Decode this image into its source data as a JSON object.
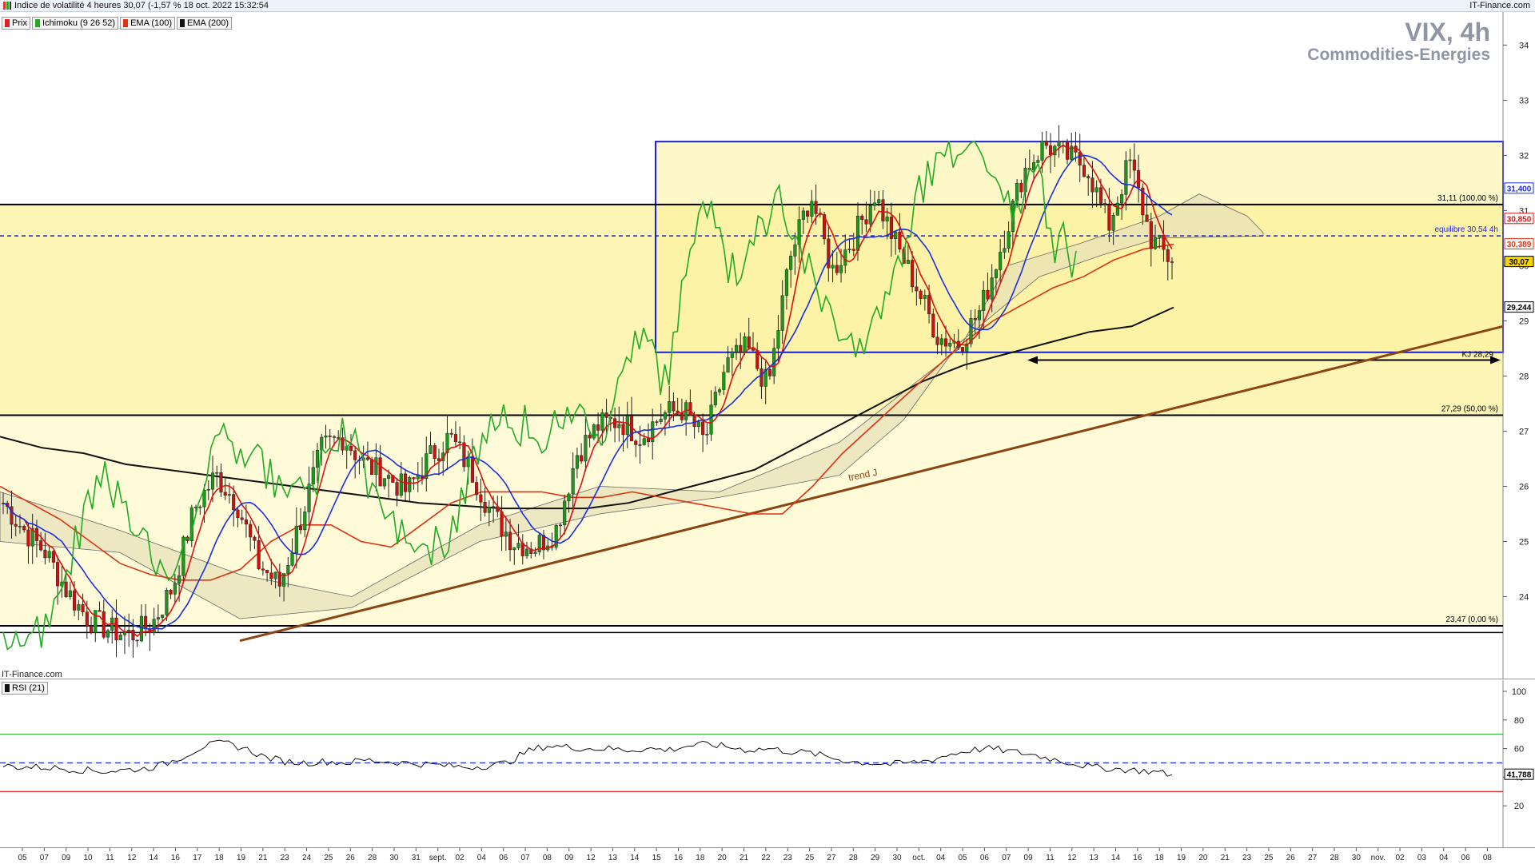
{
  "header": {
    "title": "Indice de volatilité 4 heures 30,07 (-1,57 % 18 oct. 2022 15:32:54",
    "source": "IT-Finance.com"
  },
  "legend": [
    {
      "label": "Prix",
      "color": "#dd2222"
    },
    {
      "label": "Ichimoku (9 26 52)",
      "color": "#22aa22"
    },
    {
      "label": "EMA (100)",
      "color": "#dd3311"
    },
    {
      "label": "EMA (200)",
      "color": "#111111"
    }
  ],
  "symbol": {
    "name": "VIX, 4h",
    "sector": "Commodities-Energies"
  },
  "watermark": "IT-Finance.com",
  "rsi_label": "RSI (21)",
  "colors": {
    "zone_fill": "#fdf5b5",
    "zone_light": "#fffbd9",
    "rect_stroke": "#1a1fd8",
    "trend": "#8b4513",
    "ema100": "#dd3311",
    "ema200": "#111111",
    "tenkan": "#dd1111",
    "kijun": "#1a2fdc",
    "chikou": "#22aa22",
    "cloud": "#e6dfb8",
    "rsi_line": "#111111"
  },
  "chart_data": {
    "type": "line",
    "title": "VIX, 4h",
    "subtitle": "Commodities-Energies",
    "ylim": [
      22.5,
      34.6
    ],
    "y_ticks": [
      24,
      25,
      26,
      27,
      28,
      29,
      30,
      31,
      32,
      33,
      34
    ],
    "y_tick_labels": [
      "24",
      "25",
      "26",
      "27",
      "28",
      "29",
      "30",
      "31",
      "32",
      "33",
      "34"
    ],
    "x_tick_labels": [
      "05",
      "07",
      "09",
      "10",
      "11",
      "12",
      "14",
      "16",
      "17",
      "18",
      "19",
      "21",
      "23",
      "24",
      "25",
      "26",
      "28",
      "30",
      "31",
      "sept.",
      "02",
      "04",
      "06",
      "07",
      "08",
      "09",
      "12",
      "13",
      "14",
      "15",
      "16",
      "18",
      "20",
      "21",
      "22",
      "23",
      "25",
      "27",
      "28",
      "29",
      "30",
      "oct.",
      "04",
      "05",
      "06",
      "07",
      "09",
      "11",
      "12",
      "13",
      "14",
      "16",
      "18",
      "19",
      "20",
      "21",
      "23",
      "25",
      "26",
      "27",
      "28",
      "30",
      "nov.",
      "02",
      "03",
      "04",
      "06",
      "08"
    ],
    "levels": [
      {
        "label": "31,11 (100,00 %)",
        "value": 31.11
      },
      {
        "label": "27,29 (50,00 %)",
        "value": 27.29
      },
      {
        "label": "23,47 (0,00 %)",
        "value": 23.47
      },
      {
        "label": "equilibre 30,54 4h",
        "value": 30.54
      },
      {
        "label": "KJ 28,29",
        "value": 28.29
      }
    ],
    "price_tags": [
      {
        "value": 31.4,
        "label": "31,400"
      },
      {
        "value": 30.85,
        "label": "30,850"
      },
      {
        "value": 30.389,
        "label": "30,389"
      },
      {
        "value": 30.07,
        "label": "30,07"
      },
      {
        "value": 29.244,
        "label": "29,244"
      }
    ],
    "trend_label": "trend J",
    "series": [
      {
        "values": [
          25.7,
          25.2,
          24.8,
          24.1,
          23.6,
          23.4,
          23.3,
          23.5,
          24.2,
          25.6,
          26.2,
          25.7,
          24.6,
          24.2,
          25.4,
          26.7,
          26.9,
          26.4,
          26.2,
          25.9,
          26.5,
          26.9,
          26.3,
          25.5,
          25.0,
          24.9,
          25.2,
          26.6,
          27.1,
          27.2,
          26.9,
          27.3,
          27.4,
          26.8,
          28.2,
          28.5,
          27.8,
          30.1,
          31.3,
          29.9,
          30.5,
          31.3,
          30.4,
          29.6,
          28.7,
          28.6,
          29.2,
          30.4,
          31.7,
          32.2,
          32.0,
          31.8,
          30.7,
          31.9,
          30.5,
          30.07
        ]
      },
      {
        "name": "EMA (100)",
        "values": [
          26.0,
          25.7,
          25.4,
          25.0,
          24.6,
          24.4,
          24.3,
          24.3,
          24.5,
          25.0,
          25.3,
          25.3,
          25.0,
          24.9,
          25.3,
          25.7,
          25.9,
          25.9,
          25.9,
          25.8,
          25.8,
          25.9,
          25.8,
          25.7,
          25.6,
          25.5,
          25.5,
          26.0,
          26.6,
          27.1,
          27.6,
          28.1,
          28.6,
          29.0,
          29.3,
          29.6,
          29.8,
          30.1,
          30.3,
          30.389
        ]
      },
      {
        "name": "EMA (200)",
        "values": [
          26.9,
          26.7,
          26.6,
          26.4,
          26.3,
          26.2,
          26.1,
          26.0,
          25.9,
          25.8,
          25.7,
          25.65,
          25.6,
          25.6,
          25.6,
          25.7,
          25.9,
          26.1,
          26.3,
          26.7,
          27.1,
          27.5,
          27.9,
          28.2,
          28.4,
          28.6,
          28.8,
          28.9,
          29.244
        ]
      }
    ],
    "rsi": {
      "ylim": [
        0,
        100
      ],
      "y_tick_labels": [
        "20",
        "40",
        "60",
        "80",
        "100"
      ],
      "levels": [
        70,
        50,
        30
      ],
      "last_label": "41,788",
      "values": [
        48,
        47,
        47,
        46,
        45,
        44,
        45,
        46,
        49,
        55,
        62,
        64,
        60,
        54,
        51,
        50,
        51,
        50,
        52,
        51,
        50,
        49,
        48,
        47,
        48,
        50,
        58,
        62,
        61,
        60,
        60,
        59,
        60,
        59,
        62,
        63,
        61,
        59,
        60,
        58,
        57,
        54,
        51,
        50,
        49,
        50,
        52,
        56,
        59,
        60,
        58,
        56,
        53,
        50,
        47,
        46,
        45,
        44,
        41.8
      ]
    }
  }
}
